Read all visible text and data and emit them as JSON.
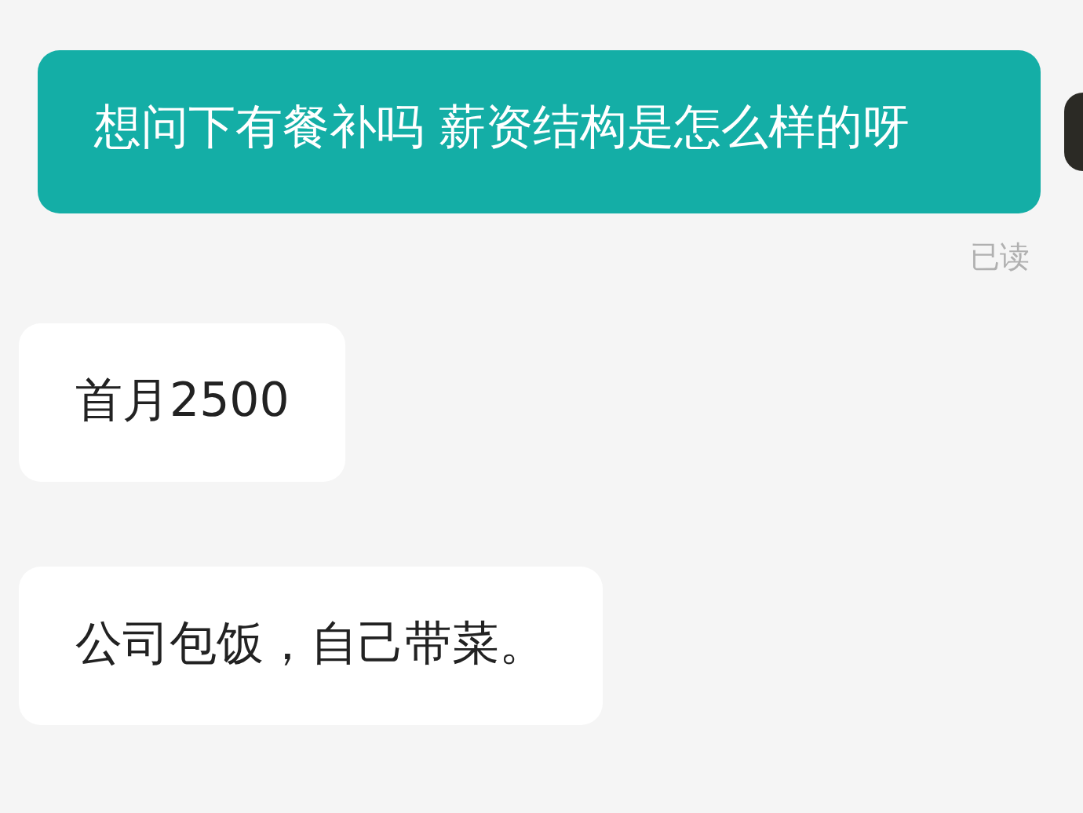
{
  "messages": [
    {
      "kind": "sent",
      "text": "想问下有餐补吗 薪资结构是怎么样的呀",
      "status": "已读"
    },
    {
      "kind": "received",
      "text": "首月2500"
    },
    {
      "kind": "received",
      "text": "公司包饭，自己带菜。"
    }
  ]
}
